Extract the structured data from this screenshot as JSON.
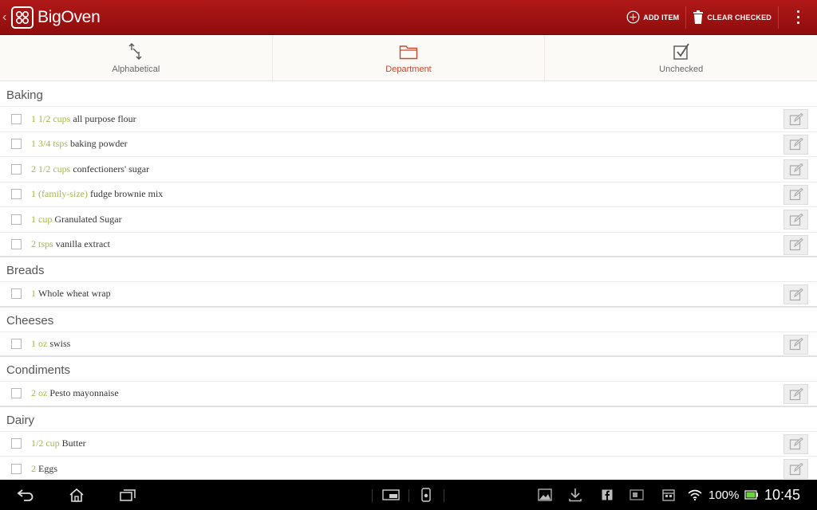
{
  "app": {
    "title": "BigOven",
    "logo_icon": "bigoven-stove-logo",
    "colors": {
      "action_bar": "#a01212",
      "quantity": "#a4b84a",
      "active_tab": "#c24a33"
    }
  },
  "actions": {
    "add_item": "ADD ITEM",
    "clear_checked": "CLEAR CHECKED"
  },
  "tabs": [
    {
      "label": "Alphabetical",
      "icon": "sort-arrows-icon",
      "active": false
    },
    {
      "label": "Department",
      "icon": "folder-icon",
      "active": true
    },
    {
      "label": "Unchecked",
      "icon": "checkbox-check-icon",
      "active": false
    }
  ],
  "sections": [
    {
      "name": "Baking",
      "items": [
        {
          "qty": "1 1/2 cups",
          "name": "all purpose flour"
        },
        {
          "qty": "1 3/4 tsps",
          "name": "baking powder"
        },
        {
          "qty": "2 1/2 cups",
          "name": "confectioners' sugar"
        },
        {
          "qty": "1 (family-size)",
          "name": "fudge brownie mix"
        },
        {
          "qty": "1 cup",
          "name": "Granulated Sugar"
        },
        {
          "qty": "2 tsps",
          "name": "vanilla extract"
        }
      ]
    },
    {
      "name": "Breads",
      "items": [
        {
          "qty": "1",
          "name": "Whole wheat wrap"
        }
      ]
    },
    {
      "name": "Cheeses",
      "items": [
        {
          "qty": "1 oz",
          "name": "swiss"
        }
      ]
    },
    {
      "name": "Condiments",
      "items": [
        {
          "qty": "2 oz",
          "name": "Pesto mayonnaise"
        }
      ]
    },
    {
      "name": "Dairy",
      "items": [
        {
          "qty": "1/2 cup",
          "name": "Butter"
        },
        {
          "qty": "2",
          "name": "Eggs"
        }
      ]
    }
  ],
  "system_bar": {
    "battery_percent": "100%",
    "time": "10:45"
  }
}
